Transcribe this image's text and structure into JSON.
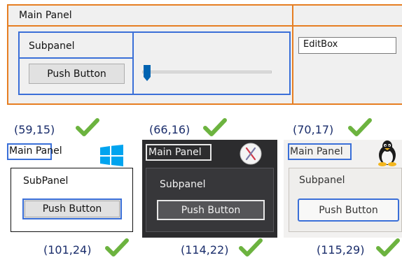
{
  "top_example": {
    "main_panel_title": "Main Panel",
    "subpanel_title": "Subpanel",
    "push_button_label": "Push Button",
    "editbox_value": "EditBox",
    "slider_level": 0.03
  },
  "platforms": [
    {
      "os_icon": "windows-logo-icon",
      "title_size": "(59,15)",
      "button_size": "(101,24)",
      "main_panel_title": "Main Panel",
      "subpanel_title": "SubPanel",
      "push_button_label": "Push Button"
    },
    {
      "os_icon": "macos-x-logo-icon",
      "title_size": "(66,16)",
      "button_size": "(114,22)",
      "main_panel_title": "Main Panel",
      "subpanel_title": "Subpanel",
      "push_button_label": "Push Button"
    },
    {
      "os_icon": "linux-tux-icon",
      "title_size": "(70,17)",
      "button_size": "(115,29)",
      "main_panel_title": "Main Panel",
      "subpanel_title": "Subpanel",
      "push_button_label": "Push Button"
    }
  ],
  "colors": {
    "main_border": "#e67e22",
    "sub_border": "#3a6fd8",
    "check_green": "#6cb33f",
    "windows_blue": "#00a4ef",
    "mac_dark": "#2c2c2e"
  }
}
